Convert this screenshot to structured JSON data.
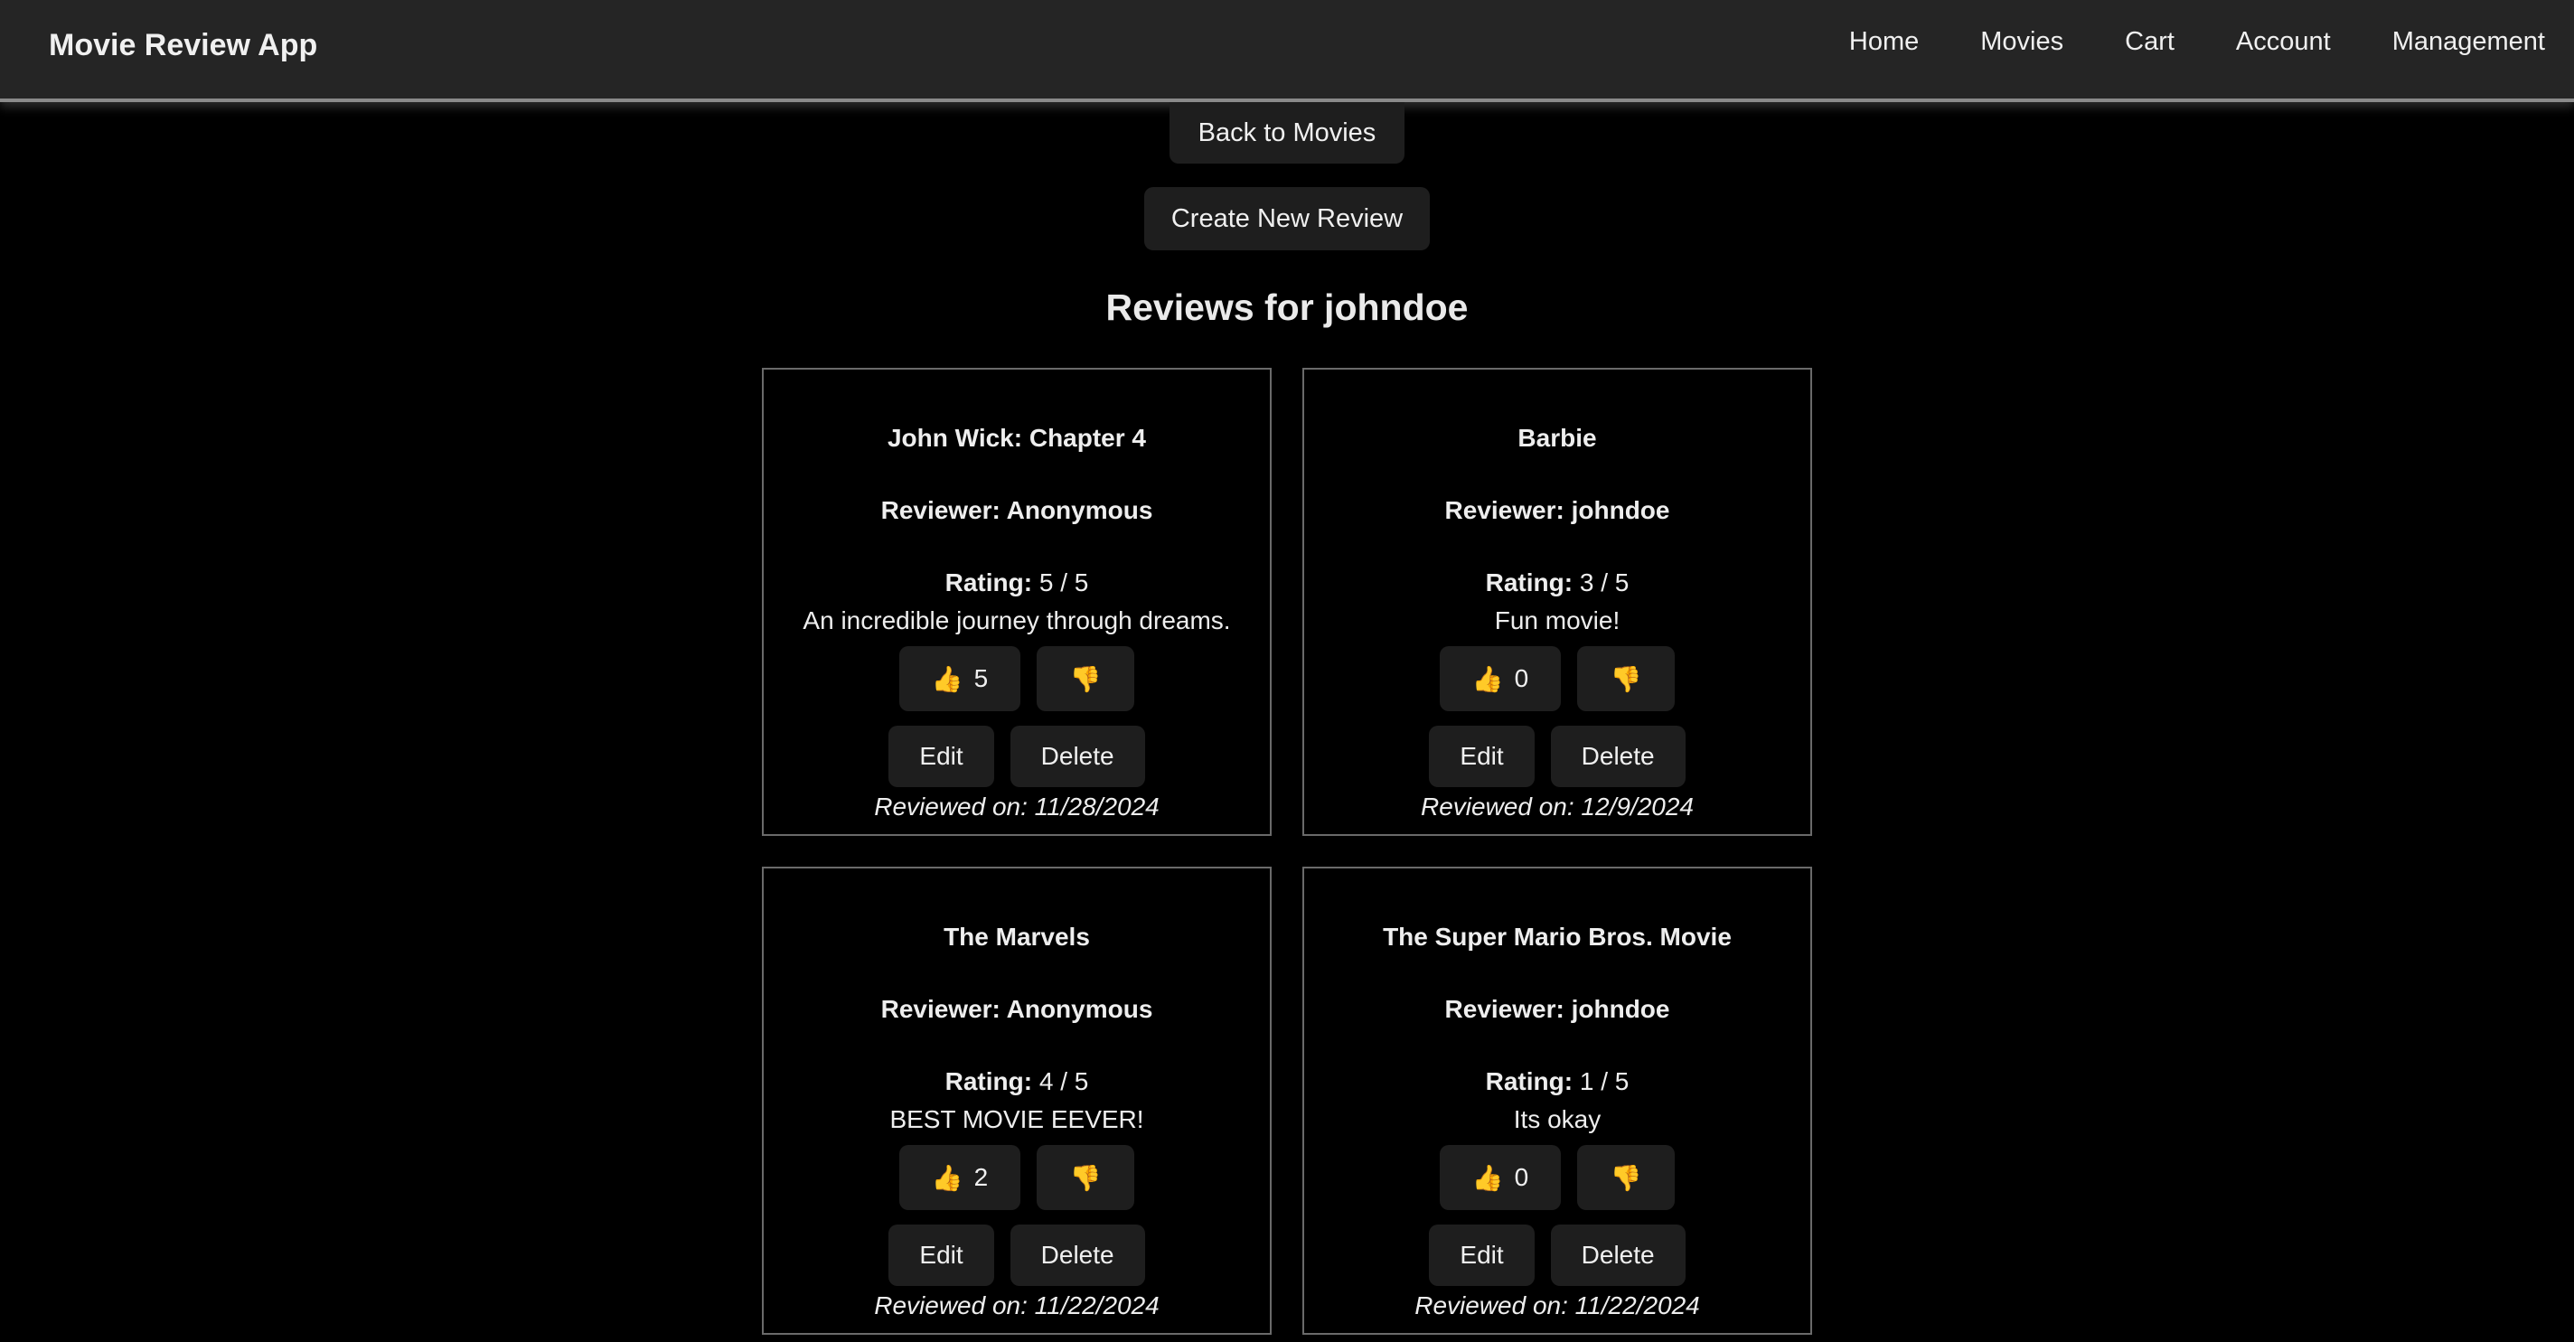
{
  "app": {
    "title": "Movie Review App"
  },
  "nav": [
    {
      "label": "Home"
    },
    {
      "label": "Movies"
    },
    {
      "label": "Cart"
    },
    {
      "label": "Account"
    },
    {
      "label": "Management"
    }
  ],
  "actions": {
    "back_label": "Back to Movies",
    "create_label": "Create New Review"
  },
  "page": {
    "title": "Reviews for johndoe"
  },
  "labels": {
    "rating": "Rating:",
    "edit": "Edit",
    "delete": "Delete"
  },
  "icons": {
    "like": "thumbs-up-icon",
    "dislike": "thumbs-down-icon",
    "like_glyph": "👍",
    "dislike_glyph": "👎"
  },
  "colors": {
    "background": "#000000",
    "navbar": "#252525",
    "button": "#1e1e1e",
    "thumb": "#f5b820"
  },
  "reviews": [
    {
      "title": "John Wick: Chapter 4",
      "reviewer": "Reviewer: Anonymous",
      "rating": "5 / 5",
      "comment": "An incredible journey through dreams.",
      "likes": "5",
      "date": "Reviewed on: 11/28/2024"
    },
    {
      "title": "Barbie",
      "reviewer": "Reviewer: johndoe",
      "rating": "3 / 5",
      "comment": "Fun movie!",
      "likes": "0",
      "date": "Reviewed on: 12/9/2024"
    },
    {
      "title": "The Marvels",
      "reviewer": "Reviewer: Anonymous",
      "rating": "4 / 5",
      "comment": "BEST MOVIE EEVER!",
      "likes": "2",
      "date": "Reviewed on: 11/22/2024"
    },
    {
      "title": "The Super Mario Bros. Movie",
      "reviewer": "Reviewer: johndoe",
      "rating": "1 / 5",
      "comment": "Its okay",
      "likes": "0",
      "date": "Reviewed on: 11/22/2024"
    }
  ]
}
